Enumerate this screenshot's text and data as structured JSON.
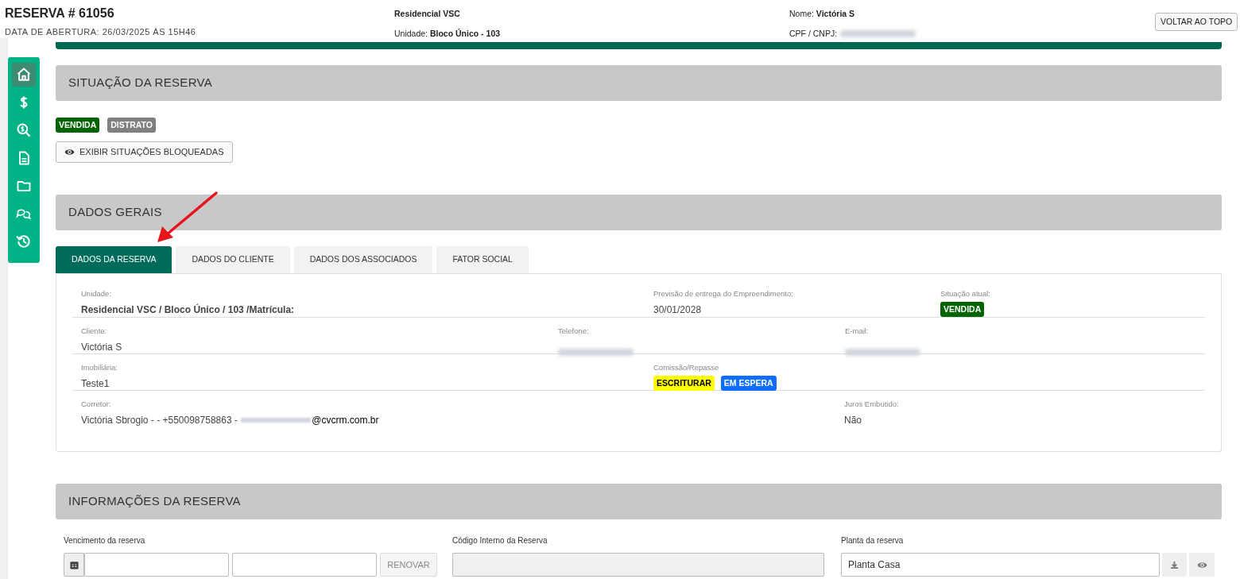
{
  "header": {
    "title": "RESERVA # 61056",
    "subtitle": "DATA DE ABERTURA: 26/03/2025 ÀS 15H46",
    "project": "Residencial VSC",
    "unit": "Unidade: **Bloco Único - 103**",
    "name": "Nome: **Victória S**",
    "document_label": "CPF / CNPJ:",
    "back_button": "VOLTAR AO TOPO"
  },
  "sidebar": {
    "items": [
      {
        "kind": "home",
        "selected": true
      },
      {
        "kind": "dollar",
        "selected": false
      },
      {
        "kind": "search-dollar",
        "selected": false
      },
      {
        "kind": "document",
        "selected": false
      },
      {
        "kind": "folder",
        "selected": false
      },
      {
        "kind": "chat",
        "selected": false
      },
      {
        "kind": "history",
        "selected": false
      }
    ]
  },
  "status_section": {
    "title": "SITUAÇÃO DA RESERVA",
    "badges": [
      {
        "label": "VENDIDA",
        "color": "#006400"
      },
      {
        "label": "DISTRATO",
        "color": "#808080"
      }
    ],
    "button": "EXIBIR SITUAÇÕES BLOQUEADAS"
  },
  "general_section": {
    "title": "DADOS GERAIS",
    "tabs": [
      {
        "label": "DADOS DA RESERVA",
        "selected": true
      },
      {
        "label": "DADOS DO CLIENTE",
        "selected": false
      },
      {
        "label": "DADOS DOS ASSOCIADOS",
        "selected": false
      },
      {
        "label": "FATOR SOCIAL",
        "selected": false
      }
    ],
    "rows": [
      [
        {
          "label": "Unidade:",
          "value": "Residencial VSC / Bloco Único / 103 /Matrícula:",
          "kind": "bold"
        },
        {
          "label": "Previsão de entrega do Empreendimento:",
          "value": "30/01/2028",
          "kind": "text"
        },
        {
          "label": "Situação atual:",
          "kind": "badges",
          "badges": [
            {
              "label": "VENDIDA",
              "color": "#006400"
            }
          ]
        }
      ],
      [
        {
          "label": "Cliente:",
          "value": "Victória S",
          "kind": "text"
        },
        {
          "label": "Telefone:",
          "kind": "hidden"
        },
        {
          "label": "E-mail:",
          "kind": "hidden"
        }
      ],
      [
        {
          "label": "Imobiliária:",
          "value": "Teste1",
          "kind": "text"
        },
        {
          "label": "Comissão/Repasse",
          "kind": "badges",
          "badges": [
            {
              "label": "ESCRITURAR",
              "color": "#ffff00"
            },
            {
              "label": "EM ESPERA",
              "color": "#0d6efd"
            }
          ]
        }
      ],
      [
        {
          "label": "Corretor:",
          "value": "Victória Sbrogio - - +550098758863 - ",
          "value_end": "@cvcrm.com.br",
          "kind": "redacted"
        },
        {
          "label": "Juros Embutido:",
          "value": "Não",
          "kind": "text"
        }
      ]
    ]
  },
  "info_section": {
    "title": "INFORMAÇÕES DA RESERVA",
    "due_label": "Vencimento da reserva",
    "renew_button": "RENOVAR",
    "code_label": "Código Interno da Reserva",
    "plan_label": "Planta da reserva",
    "plan_value": "Planta Casa"
  }
}
